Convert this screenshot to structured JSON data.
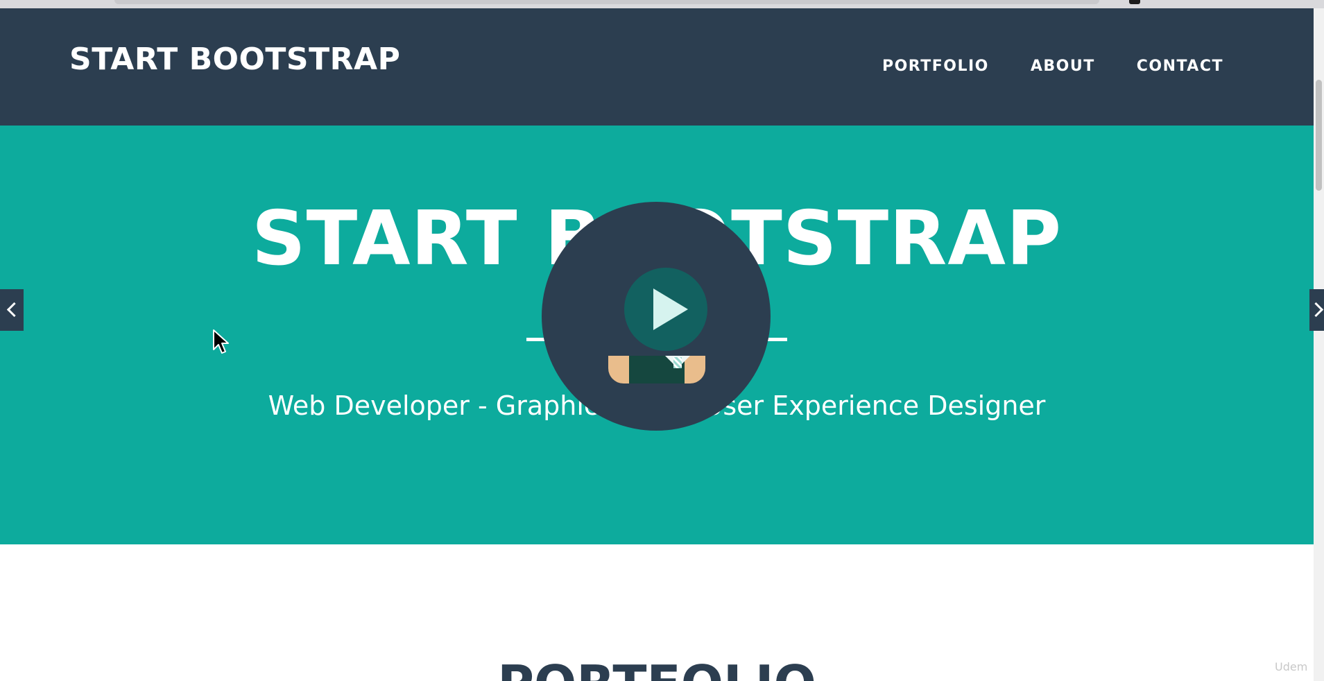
{
  "navbar": {
    "brand": "START BOOTSTRAP",
    "links": [
      {
        "label": "PORTFOLIO"
      },
      {
        "label": "ABOUT"
      },
      {
        "label": "CONTACT"
      }
    ]
  },
  "masthead": {
    "title": "START BOOTSTRAP",
    "subtitle": "Web Developer - Graphic Artist - User Experience Designer",
    "avatar_icon": "avatar-icon",
    "divider_icon": "star-icon"
  },
  "video": {
    "play_icon": "play-icon"
  },
  "carousel": {
    "prev_icon": "chevron-left-icon",
    "next_icon": "chevron-right-icon"
  },
  "portfolio": {
    "title": "PORTFOLIO"
  },
  "watermark": "Udem",
  "colors": {
    "navbar_bg": "#2c3e50",
    "masthead_bg": "#0dab9d",
    "text_light": "#ffffff",
    "heading_dark": "#2c3e50"
  }
}
